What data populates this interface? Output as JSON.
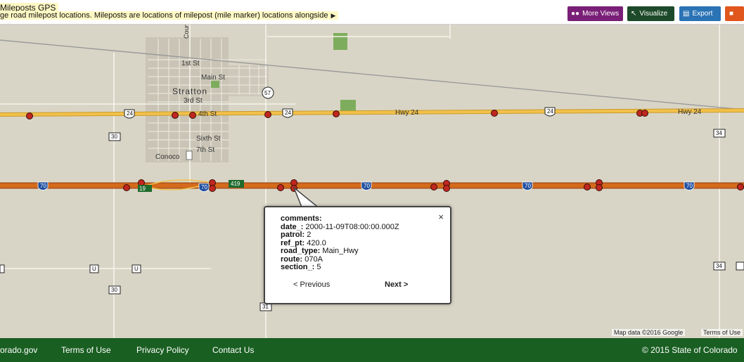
{
  "header": {
    "title": "Mileposts GPS",
    "description": "ge road milepost locations. Mileposts are locations of milepost (mile marker) locations alongside",
    "buttons": {
      "more_views": {
        "label": "More Views",
        "color": "#7a1f77"
      },
      "visualize": {
        "label": "Visualize",
        "color": "#1d4a2a"
      },
      "export": {
        "label": "Export",
        "color": "#2a73b5"
      },
      "comment_color": "#e0561c"
    }
  },
  "map": {
    "labels": {
      "county_rd": "County Rd",
      "first_st": "1st St",
      "main_st": "Main St",
      "stratton": "Stratton",
      "third_st": "3rd St",
      "fourth_st": "4th St",
      "sixth_st": "Sixth St",
      "seventh_st": "7th St",
      "conoco": "Conoco",
      "hwy24_a": "Hwy 24",
      "hwy24_b": "Hwy 24"
    },
    "shields": {
      "us24": "24",
      "i70": "70",
      "r30": "30",
      "r57": "57",
      "r34": "34",
      "r31": "31",
      "exit419": "419",
      "u": "U"
    },
    "attribution": "Map data ©2016 Google",
    "terms": "Terms of Use",
    "colors": {
      "interstate": "#d56a1c",
      "highway": "#f2c14a",
      "marker": "#c0271f"
    }
  },
  "popup": {
    "rows": [
      {
        "key": "comments:",
        "value": ""
      },
      {
        "key": "date_:",
        "value": "2000-11-09T08:00:00.000Z"
      },
      {
        "key": "patrol:",
        "value": "2"
      },
      {
        "key": "ref_pt:",
        "value": "420.0"
      },
      {
        "key": "road_type:",
        "value": "Main_Hwy"
      },
      {
        "key": "route:",
        "value": "070A"
      },
      {
        "key": "section_:",
        "value": "5"
      }
    ],
    "close": "×",
    "prev": "< Previous",
    "next": "Next >"
  },
  "footer": {
    "links": [
      "orado.gov",
      "Terms of Use",
      "Privacy Policy",
      "Contact Us"
    ],
    "copyright": "© 2015 State of Colorado"
  }
}
